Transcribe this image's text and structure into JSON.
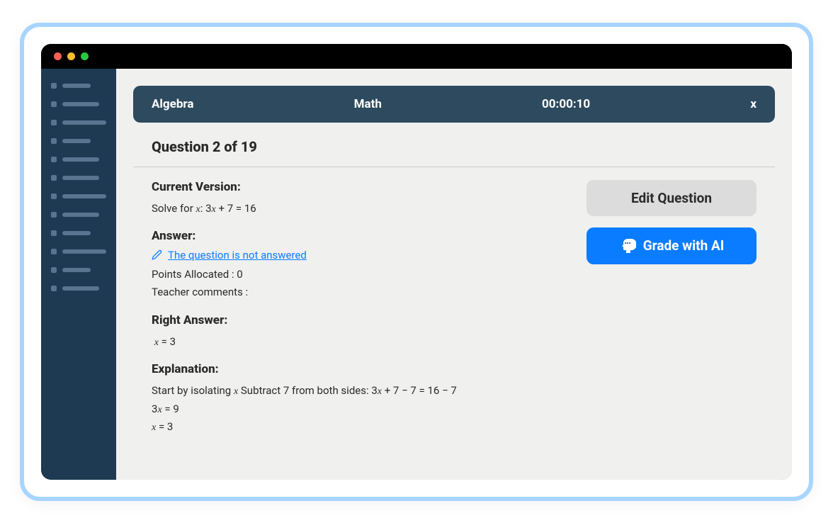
{
  "header": {
    "subject": "Algebra",
    "category": "Math",
    "timer": "00:00:10",
    "close": "x"
  },
  "question_counter": "Question 2 of 19",
  "current_version": {
    "label": "Current Version:",
    "text_before": "Solve for ",
    "var1": "x",
    "text_mid": ": 3",
    "var2": "x",
    "text_after": " + 7 = 16"
  },
  "answer": {
    "label": "Answer:",
    "status": "The question is not answered",
    "points": "Points Allocated : 0",
    "comments": "Teacher comments :"
  },
  "right_answer": {
    "label": "Right Answer:",
    "var": "x",
    "value": " = 3"
  },
  "explanation": {
    "label": "Explanation:",
    "line1_a": "Start by isolating ",
    "line1_var1": "x",
    "line1_b": " Subtract 7 from both sides: 3",
    "line1_var2": "x",
    "line1_c": " + 7 − 7 = 16 − 7",
    "line2_a": "3",
    "line2_var": "x",
    "line2_b": " = 9",
    "line3_var": "x",
    "line3_a": " = 3"
  },
  "buttons": {
    "edit": "Edit Question",
    "ai": "Grade with AI"
  }
}
